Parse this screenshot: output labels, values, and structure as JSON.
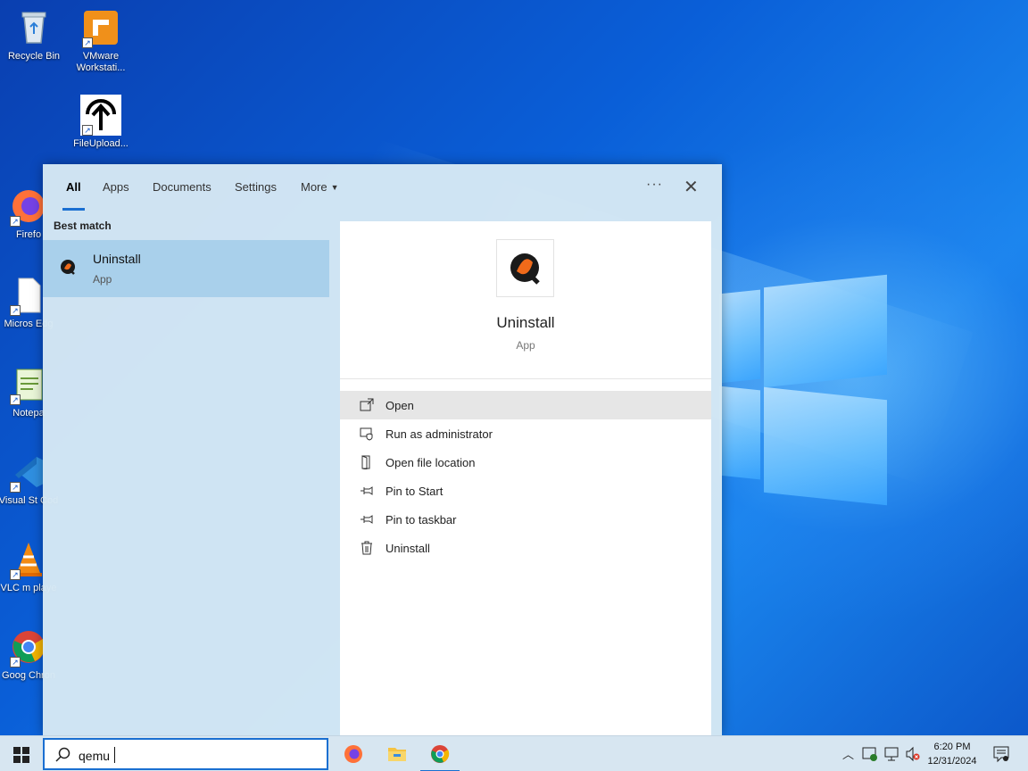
{
  "desktop": {
    "icons": [
      {
        "label": "Recycle Bin"
      },
      {
        "label": "VMware Workstati..."
      },
      {
        "label": "FileUpload..."
      },
      {
        "label": "Firefo"
      },
      {
        "label": "Micros Edg"
      },
      {
        "label": "Notepa"
      },
      {
        "label": "Visual St Cod"
      },
      {
        "label": "VLC m playe"
      },
      {
        "label": "Goog Chron"
      }
    ]
  },
  "search_panel": {
    "tabs": [
      {
        "label": "All"
      },
      {
        "label": "Apps"
      },
      {
        "label": "Documents"
      },
      {
        "label": "Settings"
      },
      {
        "label": "More"
      }
    ],
    "ellipsis": "···",
    "close": "✕",
    "best_match_label": "Best match",
    "best_match": {
      "title": "Uninstall",
      "subtitle": "App"
    },
    "detail": {
      "app_name": "Uninstall",
      "app_type": "App",
      "actions": [
        {
          "label": "Open",
          "icon": "open-icon"
        },
        {
          "label": "Run as administrator",
          "icon": "shield-icon"
        },
        {
          "label": "Open file location",
          "icon": "folder-icon"
        },
        {
          "label": "Pin to Start",
          "icon": "pin-icon"
        },
        {
          "label": "Pin to taskbar",
          "icon": "pin-icon"
        },
        {
          "label": "Uninstall",
          "icon": "trash-icon"
        }
      ]
    }
  },
  "taskbar": {
    "search_query": "qemu",
    "time": "6:20 PM",
    "date": "12/31/2024"
  },
  "colors": {
    "accent": "#1a6fd1",
    "selected_result": "#a9d0eb",
    "panel_bg": "#d6e8f4"
  }
}
